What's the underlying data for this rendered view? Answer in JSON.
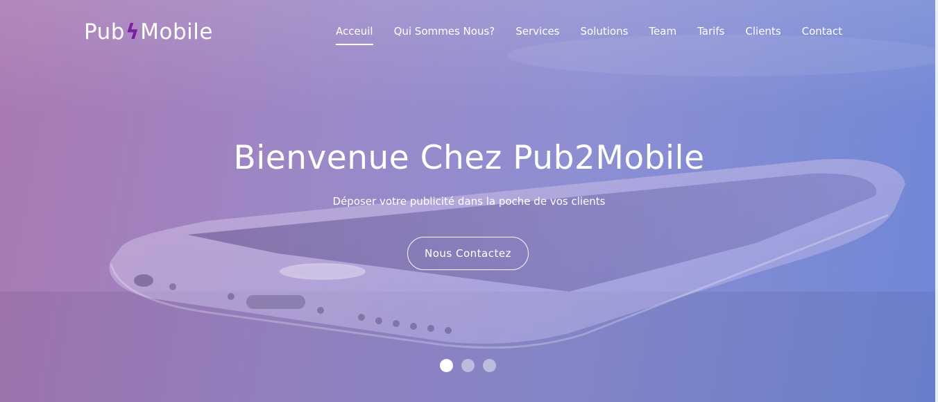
{
  "brand": {
    "logo_prefix": "Pub",
    "logo_bolt": "ϟ",
    "logo_suffix": "Mobile"
  },
  "nav": {
    "items": [
      {
        "label": "Acceuil",
        "active": true
      },
      {
        "label": "Qui Sommes Nous?",
        "active": false
      },
      {
        "label": "Services",
        "active": false
      },
      {
        "label": "Solutions",
        "active": false
      },
      {
        "label": "Team",
        "active": false
      },
      {
        "label": "Tarifs",
        "active": false
      },
      {
        "label": "Clients",
        "active": false
      },
      {
        "label": "Contact",
        "active": false
      }
    ]
  },
  "hero": {
    "title": "Bienvenue Chez Pub2Mobile",
    "subtitle": "Déposer votre publicité dans la poche de vos clients",
    "cta_label": "Nous Contactez"
  },
  "slider": {
    "count": 3,
    "active_index": 0
  },
  "colors": {
    "gradient_left": "#a978b2",
    "gradient_right": "#6f86d6",
    "bolt": "#7a1fa3"
  }
}
